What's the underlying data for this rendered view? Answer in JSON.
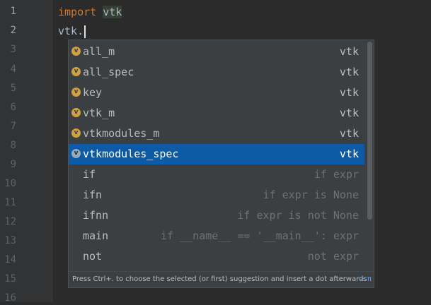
{
  "editor": {
    "line_numbers": [
      "1",
      "2",
      "3",
      "4",
      "5",
      "6",
      "7",
      "8",
      "9",
      "10",
      "11",
      "12",
      "13",
      "14",
      "15",
      "16"
    ],
    "line1": {
      "keyword": "import",
      "module": "vtk"
    },
    "line2": {
      "text": "vtk."
    }
  },
  "completion": {
    "items": [
      {
        "label": "all_m",
        "tail": "vtk",
        "icon": "variable-icon",
        "icon_letter": "v"
      },
      {
        "label": "all_spec",
        "tail": "vtk",
        "icon": "variable-icon",
        "icon_letter": "v"
      },
      {
        "label": "key",
        "tail": "vtk",
        "icon": "variable-icon",
        "icon_letter": "v"
      },
      {
        "label": "vtk_m",
        "tail": "vtk",
        "icon": "variable-icon",
        "icon_letter": "v"
      },
      {
        "label": "vtkmodules_m",
        "tail": "vtk",
        "icon": "variable-icon",
        "icon_letter": "v"
      },
      {
        "label": "vtkmodules_spec",
        "tail": "vtk",
        "icon": "variable-icon",
        "icon_letter": "v",
        "selected": true
      },
      {
        "label": "if",
        "tail": "if expr"
      },
      {
        "label": "ifn",
        "tail": "if expr is None"
      },
      {
        "label": "ifnn",
        "tail": "if expr is not None"
      },
      {
        "label": "main",
        "tail": "if __name__ == '__main__': expr"
      },
      {
        "label": "not",
        "tail": "not expr"
      }
    ],
    "footer_hint": "Press Ctrl+. to choose the selected (or first) suggestion and insert a dot afterwards",
    "footer_link": "≥ π"
  },
  "colors": {
    "background": "#2b2b2b",
    "keyword": "#cc7832",
    "selection": "#0d5aa7",
    "popup": "#3c3f41",
    "variable_icon": "#d0a23d"
  }
}
